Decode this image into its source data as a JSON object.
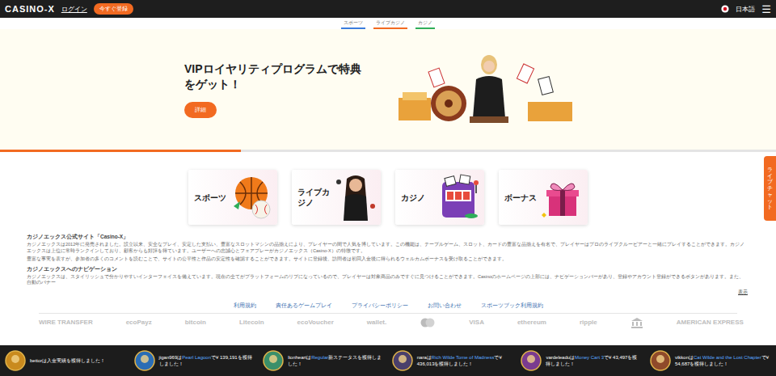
{
  "topbar": {
    "logo": "CASINO-X",
    "login": "ログイン",
    "register": "今すぐ登録",
    "language": "日本語",
    "menu": "☰"
  },
  "subnav": [
    {
      "label": "スポーツ",
      "color": "#3b7ddd"
    },
    {
      "label": "ライブカジノ",
      "color": "#f26a21"
    },
    {
      "label": "カジノ",
      "color": "#2fae5a"
    }
  ],
  "hero": {
    "title": "VIPロイヤリティプログラムで特典をゲット！",
    "button": "詳細",
    "level": 0.31
  },
  "categories": [
    {
      "label": "スポーツ",
      "kind": "sports"
    },
    {
      "label": "ライブカジノ",
      "kind": "live"
    },
    {
      "label": "カジノ",
      "kind": "casino"
    },
    {
      "label": "ボーナス",
      "kind": "bonus"
    }
  ],
  "article": {
    "blocks": [
      {
        "kind": "heading",
        "text": "カジノエックス公式サイト「Casino-X」"
      },
      {
        "kind": "paragraph",
        "text": "カジノエックスは2012年に発売されました。設立以来、安全なプレイ、安定した支払い、豊富なスロットマシンの品揃えにより、プレイヤーの間で人気を博しています。この機能は、テーブルゲーム、スロット、カードの豊富な品揃えを有名で、プレイヤーはプロのライブクルーピアーと一緒にプレイすることができます。カジノエックスは上位に常時ランクインしており、顧客からも好評を得ています。ユーザーへの忠誠心とフェアプレーがカジノエックス（Casino-X）の特徴です。"
      },
      {
        "kind": "paragraph",
        "text": "豊富な事実を表すが、参加者の多くのコメントを読むことで、サイトの公平性と作品の安定性を確認することができます。サイトに登録後、訪問者は初回入金後に得られるウェルカムボーナスを受け取ることができます。"
      },
      {
        "kind": "heading",
        "text": "カジノエックスへのナビゲーション"
      },
      {
        "kind": "paragraph",
        "text": "カジノエックスは、スタイリッシュで分かりやすいインターフェイスを備えています。現在の全てがプラットフォームのリブになっているので、プレイヤーは対象商品のみですぐに見つけることができます。Casinoのホームページの上部には、ナビゲーションバーがあり、登録やアカウント登録ができるボタンがあります。また、自動のバナー"
      }
    ],
    "more": "表示"
  },
  "footer_links": [
    "利用規約",
    "責任あるゲームプレイ",
    "プライバシーポリシー",
    "お問い合わせ",
    "スポーツブック利用規約"
  ],
  "payments": [
    {
      "kind": "text",
      "label": "WIRE TRANSFER"
    },
    {
      "kind": "text",
      "label": "ecoPayz"
    },
    {
      "kind": "text",
      "label": "bitcoin"
    },
    {
      "kind": "text",
      "label": "Litecoin"
    },
    {
      "kind": "text",
      "label": "ecoVoucher"
    },
    {
      "kind": "text",
      "label": "wallet."
    },
    {
      "kind": "mastercard",
      "label": ""
    },
    {
      "kind": "text",
      "label": "VISA"
    },
    {
      "kind": "text",
      "label": "ethereum"
    },
    {
      "kind": "text",
      "label": "ripple"
    },
    {
      "kind": "bank",
      "label": ""
    },
    {
      "kind": "text",
      "label": "AMERICAN EXPRESS"
    }
  ],
  "chat": "ライブチャット",
  "ticker": [
    {
      "user": "bettor",
      "prefix": "",
      "game": "",
      "text": "は入金実績を獲得しました！",
      "color": "#c98a1e"
    },
    {
      "user": "jigan969",
      "prefix": "は",
      "game": "Pearl Lagoon",
      "text": "で¥ 139,191を獲得しました！",
      "color": "#2a6db5"
    },
    {
      "user": "lionheart",
      "prefix": "は",
      "game": "Regular",
      "text": "新ステータスを獲得しました！",
      "color": "#3a8f6a"
    },
    {
      "user": "nara",
      "prefix": "は",
      "game": "Rich Wilde Tome of Madness",
      "text": "で¥ 436,013を獲得しました！",
      "color": "#4a3f6b"
    },
    {
      "user": "vardeleadu",
      "prefix": "は",
      "game": "Money Cart 3",
      "text": "で¥ 43,497を獲得しました！",
      "color": "#7a3b8f"
    },
    {
      "user": "vikkon",
      "prefix": "は",
      "game": "Cat Wilde and the Lost Chapter",
      "text": "で¥ 54,687を獲得しました！",
      "color": "#8f4a2a"
    }
  ]
}
